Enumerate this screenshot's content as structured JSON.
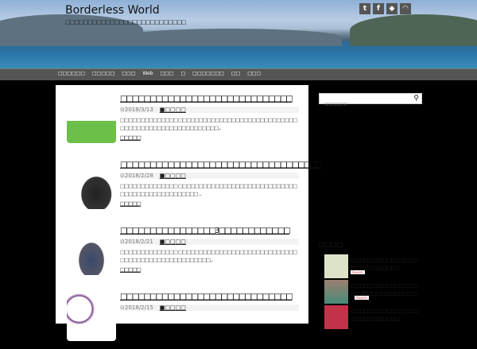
{
  "site": {
    "title": "Borderless World",
    "description": "□□□□□□□□□□□□□□□□□□□□□□□□□□□"
  },
  "social": [
    {
      "icon": "twitter-icon",
      "glyph": "t"
    },
    {
      "icon": "facebook-icon",
      "glyph": "f"
    },
    {
      "icon": "feedly-icon",
      "glyph": "◆"
    },
    {
      "icon": "rss-icon",
      "glyph": "◠"
    }
  ],
  "nav": [
    "□□□□□□",
    "□□□□□",
    "□□□",
    "Web",
    "□□□",
    "□",
    "□□□□□□□",
    "□□",
    "□□□"
  ],
  "posts": [
    {
      "title": "□□□□□□□□□□□□□□□□□□□□□□□□□□□□□",
      "date": "2018/3/13",
      "category": "□□□□",
      "excerpt": "□□□□□□□□□□□□□□ □□□□□□□□□□□□□□□□□□□□□□□□□□□□□□□□□□□□□□□□□□□□□□□□□□□□□...",
      "more": "□□□□□"
    },
    {
      "title": "□□□□□□□□□□□□□□□□□□□□□□□□□□□□□□□□□□",
      "date": "2018/2/28",
      "category": "□□□□",
      "excerpt": "□□□□□□□□□□□□□□ □□□□□□□□□□□□□□□□□□□□□□□□□□□□□□□□□□□□□□□□□□□□□□□□ ...",
      "more": "□□□□□"
    },
    {
      "title": "□□□□□□□□□□□□□□□□3□□□□□□□□□□□□",
      "date": "2018/2/21",
      "category": "□□□□",
      "excerpt": "□□□□□□□□□□□□□□ □□□□□□□□□□□□□□□□□□□□□□□□□□□□□□□□□□□□□□□□□□□□□□□□□□□...",
      "more": "□□□□□"
    },
    {
      "title": "□□□□□□□□□□□□□□□□□□□□□□□□□□□□□",
      "date": "2018/2/15",
      "category": "□□□□",
      "excerpt": "",
      "more": ""
    }
  ],
  "sidebar": {
    "search_placeholder": "□□□□□□□□",
    "popular_title": "□□□□",
    "popular": [
      {
        "text": "□□□□□□□□□□□□□□□□□□□□□□□□□□",
        "badge": "Xusers"
      },
      {
        "text": "□□□□□□□□□□□□□□□□□ 20□□□□□□□□□□□",
        "badge": "Xusers"
      },
      {
        "text": "□□□□□□□□□□□□□□□□□□□□□□□□□□",
        "badge": ""
      }
    ]
  }
}
